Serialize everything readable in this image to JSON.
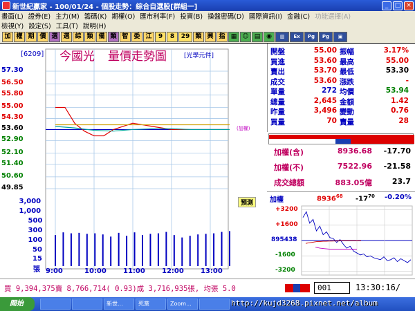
{
  "window": {
    "title": "新世紀贏家 - 100/01/24 - 個股走勢：綜合自選股[群組一]",
    "minimize": "_",
    "maximize": "□",
    "close": "×"
  },
  "menu": {
    "row1": [
      "畫面(L)",
      "證券(E)",
      "主力(M)",
      "籌碼(K)",
      "期權(O)",
      "匯市利率(F)",
      "投資(B)",
      "操盤密碼(D)",
      "國際資訊(I)",
      "金融(C)",
      "功能選擇(A)"
    ],
    "row1_disabled": [
      "功能選擇(A)"
    ],
    "row2": [
      "檢視(Y)",
      "設定(S)",
      "工具(T)",
      "說明(H)"
    ]
  },
  "toolbar": {
    "buttons": [
      "加",
      "權",
      "期",
      "價",
      "選",
      "選",
      "綜",
      "類",
      "備",
      "類",
      "智",
      "委",
      "江"
    ],
    "numbers": [
      "9",
      "8",
      "29"
    ],
    "buttons2": [
      "類",
      "興",
      "指"
    ],
    "icons": [
      "screen-icon",
      "person-icon",
      "grid-icon",
      "coin-icon",
      "chart-icon",
      "ex-icon",
      "page-icon",
      "page2-icon",
      "frame-icon"
    ]
  },
  "chart": {
    "code": "[6209]",
    "name": "今國光",
    "title": "量價走勢圖",
    "unit": "[光學元件]",
    "mark_tag": "(加權)",
    "forecast_label": "預測",
    "price_labels": [
      "57.30",
      "56.50",
      "55.80",
      "55.00",
      "54.30",
      "53.60",
      "52.90",
      "52.10",
      "51.40",
      "50.60",
      "49.85"
    ],
    "volume_labels": [
      "3,000",
      "1,000",
      "500",
      "300",
      "100",
      "50",
      "15",
      "張"
    ],
    "time_labels": [
      "9:00",
      "10:00",
      "11:00",
      "12:00",
      "13:00"
    ]
  },
  "chart_data": {
    "type": "line",
    "title": "量價走勢圖",
    "xlabel": "",
    "ylabel": "",
    "x_categories": [
      "9:00",
      "10:00",
      "11:00",
      "12:00",
      "13:00"
    ],
    "ylim": [
      49.85,
      57.3
    ],
    "reference_price": 53.6,
    "series": [
      {
        "name": "",
        "color": "#e00000",
        "x": [
          "9:00",
          "9:15",
          "9:30",
          "9:45",
          "10:00",
          "10:15",
          "10:30",
          "10:45",
          "11:00",
          "11:15",
          "11:30",
          "11:45",
          "12:00",
          "12:15",
          "12:30",
          "12:45",
          "13:00",
          "13:15",
          "13:30"
        ],
        "values": [
          55.0,
          55.0,
          54.0,
          53.5,
          53.2,
          53.2,
          53.6,
          53.8,
          54.0,
          53.9,
          53.8,
          53.7,
          53.6,
          53.6,
          53.6,
          53.6,
          53.6,
          53.6,
          53.6
        ]
      },
      {
        "name": "",
        "color": "#d0a000",
        "x": [
          "9:00",
          "13:30"
        ],
        "values": [
          53.9,
          53.9
        ]
      },
      {
        "name": "",
        "color": "#00a0a0",
        "x": [
          "9:00",
          "9:30",
          "10:00",
          "10:30",
          "11:00",
          "11:30",
          "12:00",
          "12:30",
          "13:00",
          "13:30"
        ],
        "values": [
          53.8,
          53.7,
          53.55,
          53.5,
          53.6,
          53.65,
          53.65,
          53.6,
          53.6,
          53.6
        ]
      }
    ],
    "volume": {
      "color": "#0000c0",
      "values": [
        100,
        150,
        130,
        140,
        120,
        130,
        110,
        80,
        140,
        90,
        150,
        100,
        120,
        130,
        160,
        100,
        70,
        90,
        110,
        120,
        130,
        160,
        180
      ]
    }
  },
  "quote": {
    "rows": [
      {
        "l1": "開盤",
        "v1": "55.00",
        "c1": "red",
        "l2": "振幅",
        "v2": "3.17%",
        "c2": "red"
      },
      {
        "l1": "買進",
        "v1": "53.60",
        "c1": "red",
        "l2": "最高",
        "v2": "55.00",
        "c2": "red"
      },
      {
        "l1": "賣出",
        "v1": "53.70",
        "c1": "red",
        "l2": "最低",
        "v2": "53.30",
        "c2": "blk"
      },
      {
        "l1": "成交",
        "v1": "53.60",
        "c1": "red",
        "l2": "漲跌",
        "v2": "-",
        "c2": "red"
      },
      {
        "l1": "單量",
        "v1": "272",
        "c1": "blu",
        "l2": "均價",
        "v2": "53.94",
        "c2": "grn"
      },
      {
        "l1": "總量",
        "v1": "2,645",
        "c1": "red",
        "l2": "金額",
        "v2": "1.42",
        "c2": "red"
      },
      {
        "l1": "昨量",
        "v1": "3,496",
        "c1": "red",
        "l2": "變動",
        "v2": "0.76",
        "c2": "red"
      },
      {
        "l1": "買量",
        "v1": "70",
        "c1": "red",
        "l2": "賣量",
        "v2": "28",
        "c2": "red"
      }
    ]
  },
  "index": {
    "rows": [
      {
        "label": "加權(含)",
        "value": "8936.68",
        "change": "-17.70"
      },
      {
        "label": "加權(不)",
        "value": "7522.96",
        "change": "-21.58"
      },
      {
        "label": "成交總額",
        "value": "883.05億",
        "change": "23.7"
      }
    ]
  },
  "mini": {
    "label": "加權",
    "value": "8936",
    "value_sup": "68",
    "change": "-17",
    "change_sup": "70",
    "pct": "-0.20%",
    "ylabels": [
      "+3200",
      "+1600",
      "895438",
      "-1600",
      "-3200"
    ]
  },
  "mini_data": {
    "type": "line",
    "series": [
      {
        "name": "",
        "color": "#0000c0",
        "values": [
          2400,
          3000,
          1800,
          2200,
          1000,
          1500,
          600,
          900,
          300,
          200,
          -200,
          100,
          -400,
          -800,
          -600,
          -1100,
          -1300,
          -1500,
          -1400,
          -1700,
          -1600,
          -1800,
          -1900,
          -2000,
          -1700,
          -2100,
          -2000,
          -1800,
          -2200,
          -1900,
          -2100,
          -2300,
          -2000
        ]
      },
      {
        "name": "",
        "color": "#d00000",
        "values": [
          -300,
          -250,
          -200,
          -150,
          -100,
          -100,
          -80,
          -80,
          -60,
          -60,
          -50,
          -50,
          -40,
          -40,
          -40,
          -40,
          -40,
          -40,
          -40,
          -40
        ]
      },
      {
        "name": "",
        "color": "#c000c0",
        "values": [
          -700,
          -800,
          -850,
          -900,
          -900,
          -900,
          -900,
          -900,
          -900,
          -900
        ]
      }
    ]
  },
  "status": {
    "text": "買 9,394,375賣 8,766,714( 0.93)成 3,716,935張, 均張 5.0",
    "code": "001",
    "time": "13:30:16/"
  },
  "taskbar": {
    "start": "開始",
    "tasks": [
      "",
      "",
      "新世...",
      "死黨",
      "Zoom...",
      ""
    ]
  },
  "watermark": "http://kujd3268.pixnet.net/album"
}
